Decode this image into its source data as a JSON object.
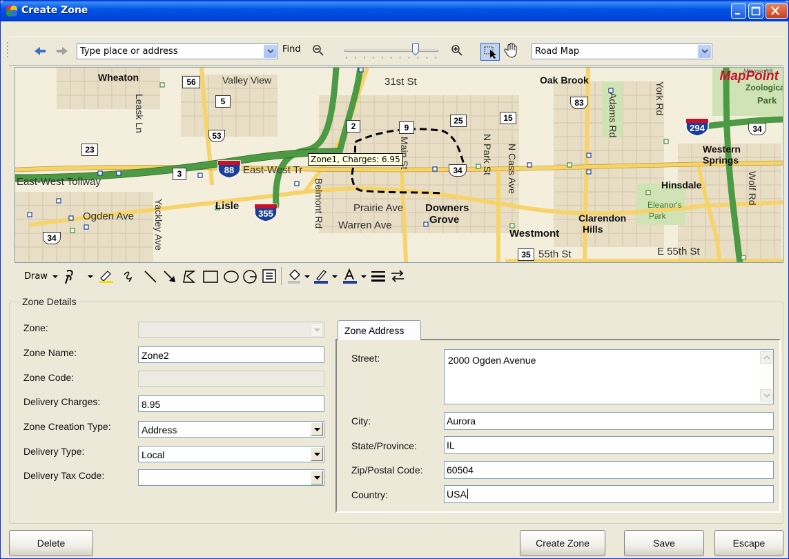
{
  "window": {
    "title": "Create Zone"
  },
  "toolbar": {
    "address_value": "Type place or address",
    "find_label": "Find",
    "map_style_value": "Road Map"
  },
  "map": {
    "tooltip": "Zone1, Charges: 6.95",
    "logo_ms": "Microsoft®",
    "logo": "MapPoint",
    "labels": {
      "wheaton": "Wheaton",
      "valley_view": "Valley View",
      "31st": "31st St",
      "oak_brook": "Oak Brook",
      "york": "York Rd",
      "adams": "Adams Rd",
      "leask": "Leask Ln",
      "eastwest_tollway": "East-West Tollway",
      "eastwest_tr": "East-West Tr",
      "ogden": "Ogden Ave",
      "yackley": "Yackley Ave",
      "lisle": "Lisle",
      "belmont": "Belmont Rd",
      "prairie": "Prairie Ave",
      "downers": "Downers",
      "grove": "Grove",
      "warren": "Warren Ave",
      "mainst": "Main St",
      "npark": "N Park St",
      "ncass": "N Cass Ave",
      "westmont": "Westmont",
      "clarendon": "Clarendon",
      "hills": "Hills",
      "55th": "55th St",
      "e55th": "E 55th St",
      "hinsdale": "Hinsdale",
      "western": "Western",
      "springs": "Springs",
      "eleanors": "Eleanor's",
      "park_el": "Park",
      "wolf": "Wolf Rd",
      "zoological": "Zoological",
      "zoo_park": "Park"
    },
    "shields": {
      "s56": "56",
      "s5": "5",
      "s53": "53",
      "s23": "23",
      "s3": "3",
      "s2": "2",
      "s9": "9",
      "s25": "25",
      "s15": "15",
      "s83": "83",
      "s34a": "34",
      "s34b": "34",
      "s34c": "34",
      "s35": "35",
      "i88": "88",
      "i355": "355",
      "i294": "294"
    }
  },
  "drawbar": {
    "draw_label": "Draw"
  },
  "zone_details": {
    "group_title": "Zone Details",
    "zone": {
      "label": "Zone:",
      "value": ""
    },
    "zone_name": {
      "label": "Zone Name:",
      "value": "Zone2"
    },
    "zone_code": {
      "label": "Zone Code:",
      "value": ""
    },
    "delivery_charges": {
      "label": "Delivery Charges:",
      "value": "8.95"
    },
    "zone_creation_type": {
      "label": "Zone Creation Type:",
      "value": "Address"
    },
    "delivery_type": {
      "label": "Delivery Type:",
      "value": "Local"
    },
    "delivery_tax_code": {
      "label": "Delivery Tax Code:",
      "value": ""
    }
  },
  "zone_address": {
    "tab_label": "Zone Address",
    "street": {
      "label": "Street:",
      "value": "2000 Ogden Avenue"
    },
    "city": {
      "label": "City:",
      "value": "Aurora"
    },
    "state": {
      "label": "State/Province:",
      "value": "IL"
    },
    "zip": {
      "label": "Zip/Postal Code:",
      "value": "60504"
    },
    "country": {
      "label": "Country:",
      "value": "USA"
    }
  },
  "buttons": {
    "delete": "Delete",
    "create_zone": "Create Zone",
    "save": "Save",
    "escape": "Escape"
  },
  "colors": {
    "titlebar": "#0054e3",
    "window_bg": "#ece9d8",
    "interstate": "#4c9a43",
    "major_road": "#f6d46b"
  }
}
